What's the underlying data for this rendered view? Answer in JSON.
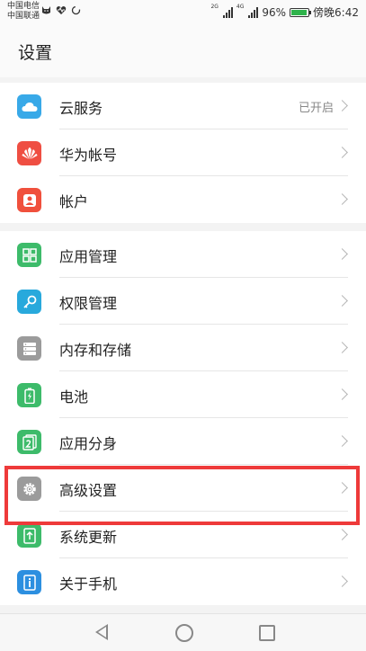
{
  "status_bar": {
    "carrier_1": "中国电信",
    "carrier_2": "中国联通",
    "net_1": "2G",
    "net_2": "4G",
    "battery": "96%",
    "time": "傍晚6:42",
    "battery_color": "#2fb34b"
  },
  "header": {
    "title": "设置"
  },
  "groups": [
    {
      "items": [
        {
          "label": "云服务",
          "value": "已开启",
          "icon": "cloud-icon",
          "color": "#38a9e8"
        },
        {
          "label": "华为帐号",
          "icon": "huawei-icon",
          "color": "#ef4e42"
        },
        {
          "label": "帐户",
          "icon": "user-icon",
          "color": "#f0503c"
        }
      ]
    },
    {
      "items": [
        {
          "label": "应用管理",
          "icon": "apps-grid-icon",
          "color": "#3dbb6a"
        },
        {
          "label": "权限管理",
          "icon": "key-icon",
          "color": "#28a9dc"
        },
        {
          "label": "内存和存储",
          "icon": "storage-icon",
          "color": "#9b9b9b"
        },
        {
          "label": "电池",
          "icon": "battery-icon",
          "color": "#3dbb6a"
        },
        {
          "label": "应用分身",
          "icon": "app-twin-icon",
          "color": "#3dbb6a"
        },
        {
          "label": "高级设置",
          "icon": "gear-icon",
          "color": "#9b9b9b"
        },
        {
          "label": "系统更新",
          "icon": "system-update-icon",
          "color": "#3dbb6a"
        },
        {
          "label": "关于手机",
          "icon": "info-icon",
          "color": "#2c8fe0"
        }
      ]
    }
  ],
  "highlight_color": "#ee3a3a"
}
